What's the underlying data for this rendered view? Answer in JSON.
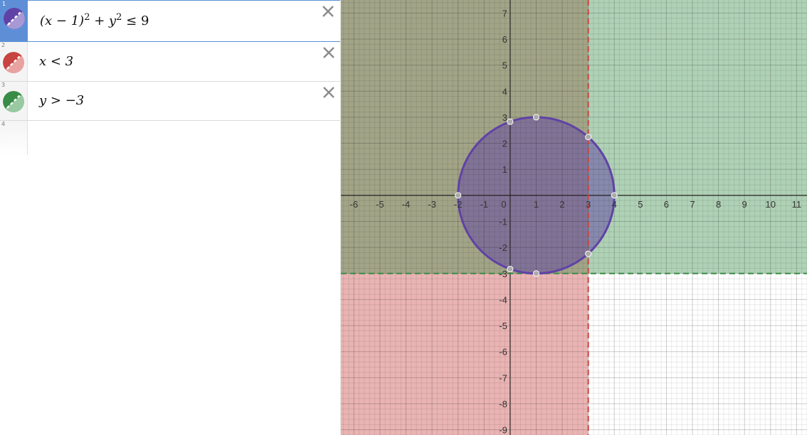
{
  "expressions": [
    {
      "index": "1",
      "pre": "(x − 1)",
      "sup1": "2",
      "mid": " + y",
      "sup2": "2",
      "post": " ≤ 9",
      "color": "#6042a6",
      "active": true
    },
    {
      "index": "2",
      "text": "x < 3",
      "color": "#c74440"
    },
    {
      "index": "3",
      "text": "y > −3",
      "color": "#388c46"
    },
    {
      "index": "4",
      "text": ""
    }
  ],
  "graph": {
    "x_ticks": [
      "-6",
      "-5",
      "-4",
      "-3",
      "-2",
      "-1",
      "0",
      "1",
      "2",
      "3",
      "4",
      "5",
      "6",
      "7",
      "8",
      "9",
      "10",
      "11"
    ],
    "y_ticks": [
      "7",
      "6",
      "5",
      "4",
      "3",
      "2",
      "1",
      "-1",
      "-2",
      "-3",
      "-4",
      "-5",
      "-6",
      "-7",
      "-8",
      "-9"
    ],
    "x_range": [
      -6.5,
      11.4
    ],
    "y_range": [
      -9.2,
      7.5
    ],
    "circle": {
      "center_x": 1,
      "center_y": 0,
      "radius": 3,
      "color": "#6042a6"
    },
    "line_x": {
      "value": 3,
      "color": "#c74440"
    },
    "line_y": {
      "value": -3,
      "color": "#388c46"
    },
    "points": [
      [
        -2,
        0
      ],
      [
        4,
        0
      ],
      [
        1,
        3
      ],
      [
        1,
        -3
      ],
      [
        0,
        2.83
      ],
      [
        0,
        -2.83
      ],
      [
        3,
        2.24
      ],
      [
        3,
        -2.24
      ]
    ]
  }
}
